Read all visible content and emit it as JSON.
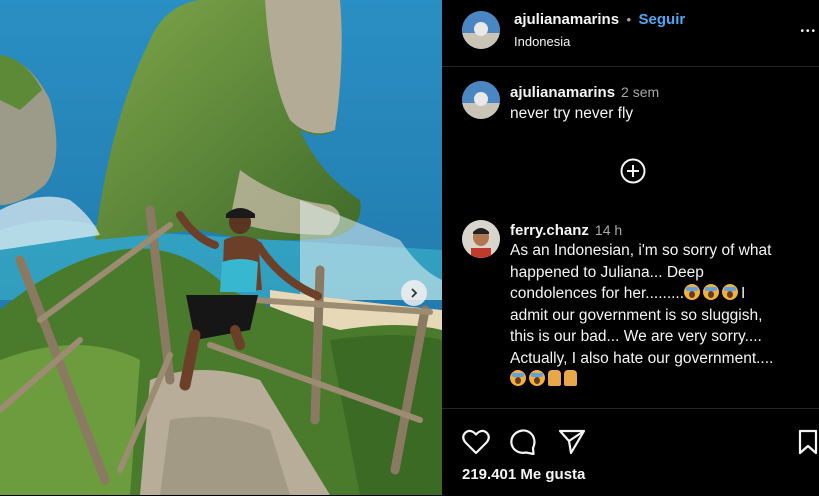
{
  "post": {
    "username": "ajulianamarins",
    "separator": "•",
    "follow_label": "Seguir",
    "location": "Indonesia",
    "more_label": "•••"
  },
  "caption": {
    "username": "ajulianamarins",
    "time": "2 sem",
    "text": "never try never fly"
  },
  "comment": {
    "username": "ferry.chanz",
    "time": "14 h",
    "lines": [
      "As an Indonesian, i'm so sorry of what",
      "happened to Juliana... Deep",
      "condolences for her.........",
      "admit our government is so sluggish,",
      "this is our bad... We are very sorry....",
      "Actually, I also hate our government...."
    ],
    "line3_suffix": "I"
  },
  "likes": {
    "count_text": "219.401 Me gusta"
  },
  "icons": {
    "next": "chevron-right-icon",
    "plus": "plus-circle-icon",
    "like": "heart-icon",
    "comment": "comment-icon",
    "share": "share-icon",
    "save": "bookmark-icon"
  },
  "colors": {
    "follow": "#4ea6f5",
    "background": "#000000",
    "meta": "#a8a8a8"
  }
}
